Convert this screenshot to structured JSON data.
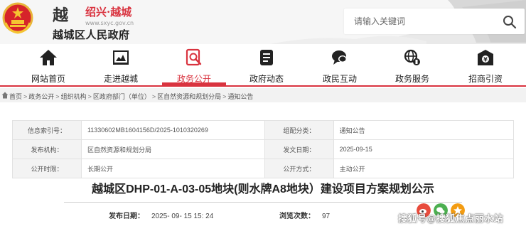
{
  "site": {
    "logo_char": "越",
    "city_name": "绍兴·越城",
    "url": "www.sxyc.gov.cn",
    "gov_name": "越城区人民政府"
  },
  "search": {
    "placeholder": "请输入关键词"
  },
  "nav": {
    "items": [
      {
        "label": "网站首页",
        "icon": "home-icon"
      },
      {
        "label": "走进越城",
        "icon": "city-overview-icon"
      },
      {
        "label": "政务公开",
        "icon": "gov-open-icon"
      },
      {
        "label": "政府动态",
        "icon": "news-document-icon"
      },
      {
        "label": "政民互动",
        "icon": "chat-bubble-icon"
      },
      {
        "label": "政务服务",
        "icon": "globe-service-icon"
      },
      {
        "label": "招商引资",
        "icon": "investment-icon"
      }
    ],
    "active_index": 2
  },
  "breadcrumb": {
    "items": [
      "首页",
      "政务公开",
      "组织机构",
      "区政府部门（单位）",
      "区自然资源和规划分局",
      "通知公告"
    ],
    "separator": ">"
  },
  "info": {
    "rows": [
      [
        {
          "label": "信息索引号：",
          "value": "11330602MB1604156D/2025-1010320269"
        },
        {
          "label": "组配分类：",
          "value": "通知公告"
        }
      ],
      [
        {
          "label": "发布机构：",
          "value": "区自然资源和规划分局"
        },
        {
          "label": "发文日期：",
          "value": "2025-09-15"
        }
      ],
      [
        {
          "label": "公开时限：",
          "value": "长期公开"
        },
        {
          "label": "公开方式：",
          "value": "主动公开"
        }
      ]
    ]
  },
  "article": {
    "title": "越城区DHP-01-A-03-05地块(则水牌A8地块）建设项目方案规划公示",
    "publish_label": "发布日期：",
    "publish_date": "2025- 09- 15 15: 24",
    "views_label": "浏览次数：",
    "views": "97"
  },
  "watermark": "搜狐号@搜狐焦点丽水站",
  "colors": {
    "accent": "#d9333f",
    "share_red": "#e84b3c",
    "share_green": "#4caf50",
    "share_orange": "#f39c12"
  }
}
